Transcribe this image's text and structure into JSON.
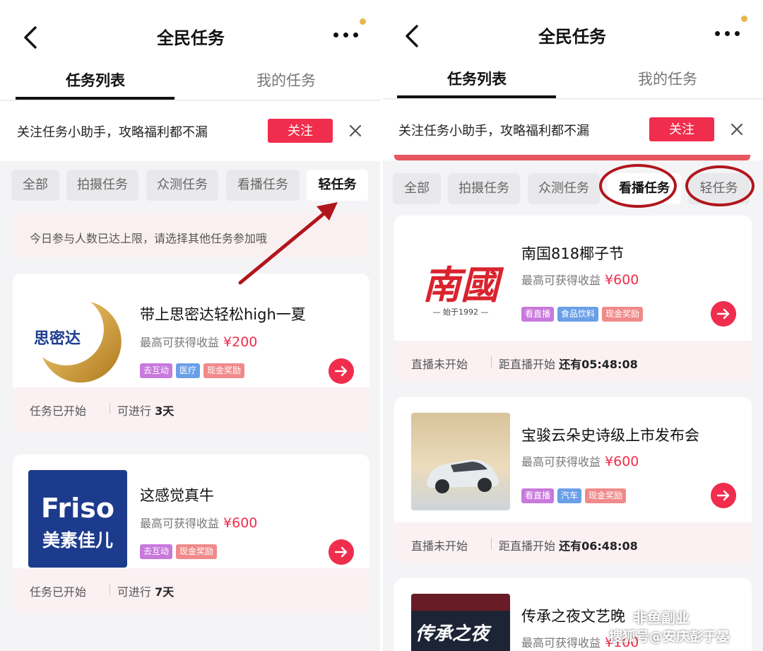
{
  "colors": {
    "accent": "#f02d4d",
    "tag_purple": "#c879dc",
    "tag_blue": "#6a9fe8",
    "tag_pink": "#f08a8a",
    "tag_food": "#a89bef"
  },
  "left": {
    "title": "全民任务",
    "tabs": [
      "任务列表",
      "我的任务"
    ],
    "follow": {
      "text": "关注任务小助手，攻略福利都不漏",
      "button": "关注"
    },
    "chips": [
      "全部",
      "拍摄任务",
      "众测任务",
      "看播任务",
      "轻任务"
    ],
    "notice": "今日参与人数已达上限，请选择其他任务参加哦",
    "cards": [
      {
        "logo_text": "思密达",
        "title": "带上思密达轻松high一夏",
        "reward_label": "最高可获得收益",
        "reward_amount": "¥200",
        "tags": [
          "去互动",
          "医疗",
          "现金奖励"
        ],
        "status": "任务已开始",
        "remaining_label": "可进行",
        "remaining_value": "3天"
      },
      {
        "logo_text_1": "Friso",
        "logo_text_2": "美素佳儿",
        "title": "这感觉真牛",
        "reward_label": "最高可获得收益",
        "reward_amount": "¥600",
        "tags": [
          "去互动",
          "现金奖励"
        ],
        "status": "任务已开始",
        "remaining_label": "可进行",
        "remaining_value": "7天"
      }
    ]
  },
  "right": {
    "title": "全民任务",
    "tabs": [
      "任务列表",
      "我的任务"
    ],
    "follow": {
      "text": "关注任务小助手，攻略福利都不漏",
      "button": "关注"
    },
    "chips": [
      "全部",
      "拍摄任务",
      "众测任务",
      "看播任务",
      "轻任务"
    ],
    "cards": [
      {
        "logo_text": "南國",
        "logo_sub": "— 始于1992 —",
        "title": "南国818椰子节",
        "reward_label": "最高可获得收益",
        "reward_amount": "¥600",
        "tags": [
          "看直播",
          "食品饮料",
          "现金奖励"
        ],
        "status": "直播未开始",
        "countdown_label": "距直播开始",
        "countdown_value": "还有05:48:08"
      },
      {
        "title": "宝骏云朵史诗级上市发布会",
        "reward_label": "最高可获得收益",
        "reward_amount": "¥600",
        "tags": [
          "看直播",
          "汽车",
          "现金奖励"
        ],
        "status": "直播未开始",
        "countdown_label": "距直播开始",
        "countdown_value": "还有06:48:08"
      },
      {
        "logo_text": "传承之夜",
        "title": "传承之夜文艺晚",
        "reward_label": "最高可获得收益",
        "reward_amount": "¥100"
      }
    ]
  },
  "watermark": {
    "line1": "非鱼副业",
    "line2": "搜狐号@安庆彭于晏"
  }
}
